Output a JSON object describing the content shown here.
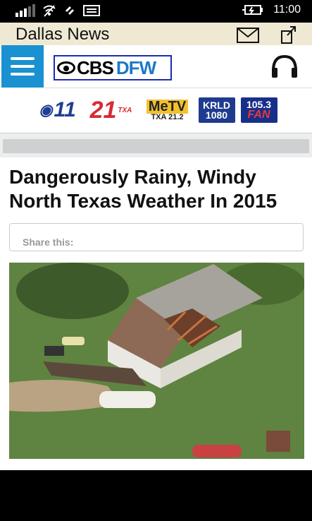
{
  "status_bar": {
    "time": "11:00"
  },
  "app_bar": {
    "title": "Dallas News"
  },
  "header": {
    "logo_cbs": "CBS",
    "logo_dfw": "DFW"
  },
  "stations": {
    "s11": "11",
    "s21": "21",
    "s21_sub": "TXA",
    "metv": "MeTV",
    "metv_sub": "TXA 21.2",
    "krld": "KRLD",
    "krld_num": "1080",
    "fan_num": "105.3",
    "fan_label": "FAN"
  },
  "article": {
    "headline": "Dangerously Rainy, Windy North Texas Weather In 2015",
    "share_label": "Share this:"
  },
  "colors": {
    "menu_blue": "#1a91d1",
    "app_bar_bg": "#efe9d4",
    "logo_border": "#1c2bb3"
  }
}
